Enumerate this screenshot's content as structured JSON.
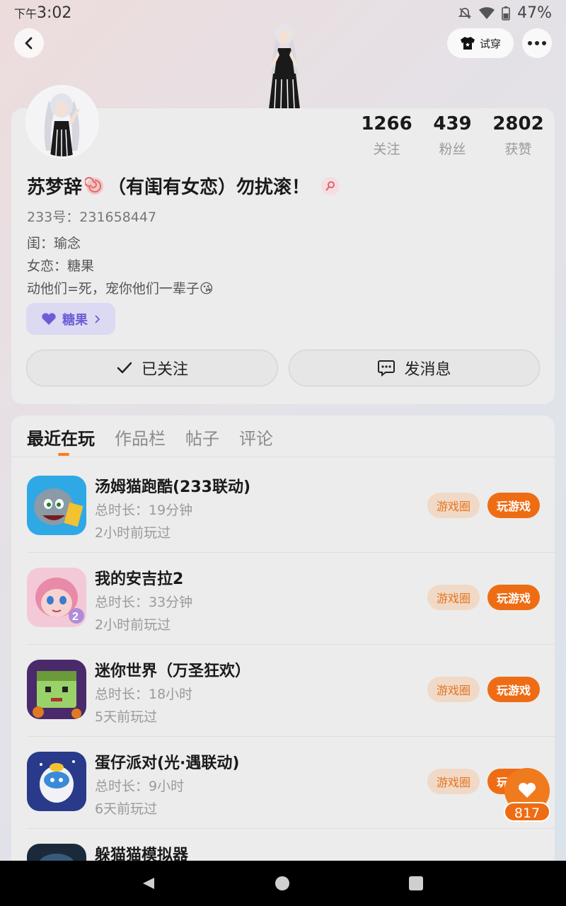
{
  "status_bar": {
    "ampm": "下午",
    "time": "3:02",
    "battery": "47%"
  },
  "header": {
    "tryon_label": "试穿"
  },
  "profile": {
    "stats": [
      {
        "value": "1266",
        "label": "关注"
      },
      {
        "value": "439",
        "label": "粉丝"
      },
      {
        "value": "2802",
        "label": "获赞"
      }
    ],
    "nickname_part1": "苏梦辞",
    "nickname_part2": "（有闺有女恋）勿扰滚！",
    "uid": "233号：231658447",
    "bio_lines": [
      "闺：瑜念",
      "女恋：糖果",
      "动他们=死，宠你他们一辈子😘"
    ],
    "tag_label": "糖果",
    "follow_label": "已关注",
    "message_label": "发消息"
  },
  "tabs": [
    {
      "label": "最近在玩",
      "active": true
    },
    {
      "label": "作品栏",
      "active": false
    },
    {
      "label": "帖子",
      "active": false
    },
    {
      "label": "评论",
      "active": false
    }
  ],
  "games": [
    {
      "title": "汤姆猫跑酷(233联动)",
      "duration": "总时长：19分钟",
      "last_played": "2小时前玩过",
      "icon": "tom-cat-icon"
    },
    {
      "title": "我的安吉拉2",
      "duration": "总时长：33分钟",
      "last_played": "2小时前玩过",
      "icon": "angela-icon"
    },
    {
      "title": "迷你世界（万圣狂欢）",
      "duration": "总时长：18小时",
      "last_played": "5天前玩过",
      "icon": "mini-world-icon"
    },
    {
      "title": "蛋仔派对(光·遇联动)",
      "duration": "总时长：9小时",
      "last_played": "6天前玩过",
      "icon": "eggy-party-icon"
    },
    {
      "title": "躲猫猫模拟器",
      "duration": "",
      "last_played": "",
      "icon": "hide-seek-icon"
    }
  ],
  "game_buttons": {
    "circle_label": "游戏圈",
    "play_label": "玩游戏"
  },
  "like": {
    "count": "817"
  },
  "colors": {
    "accent": "#ee6c13",
    "tag_purple": "#6b5fd6"
  }
}
